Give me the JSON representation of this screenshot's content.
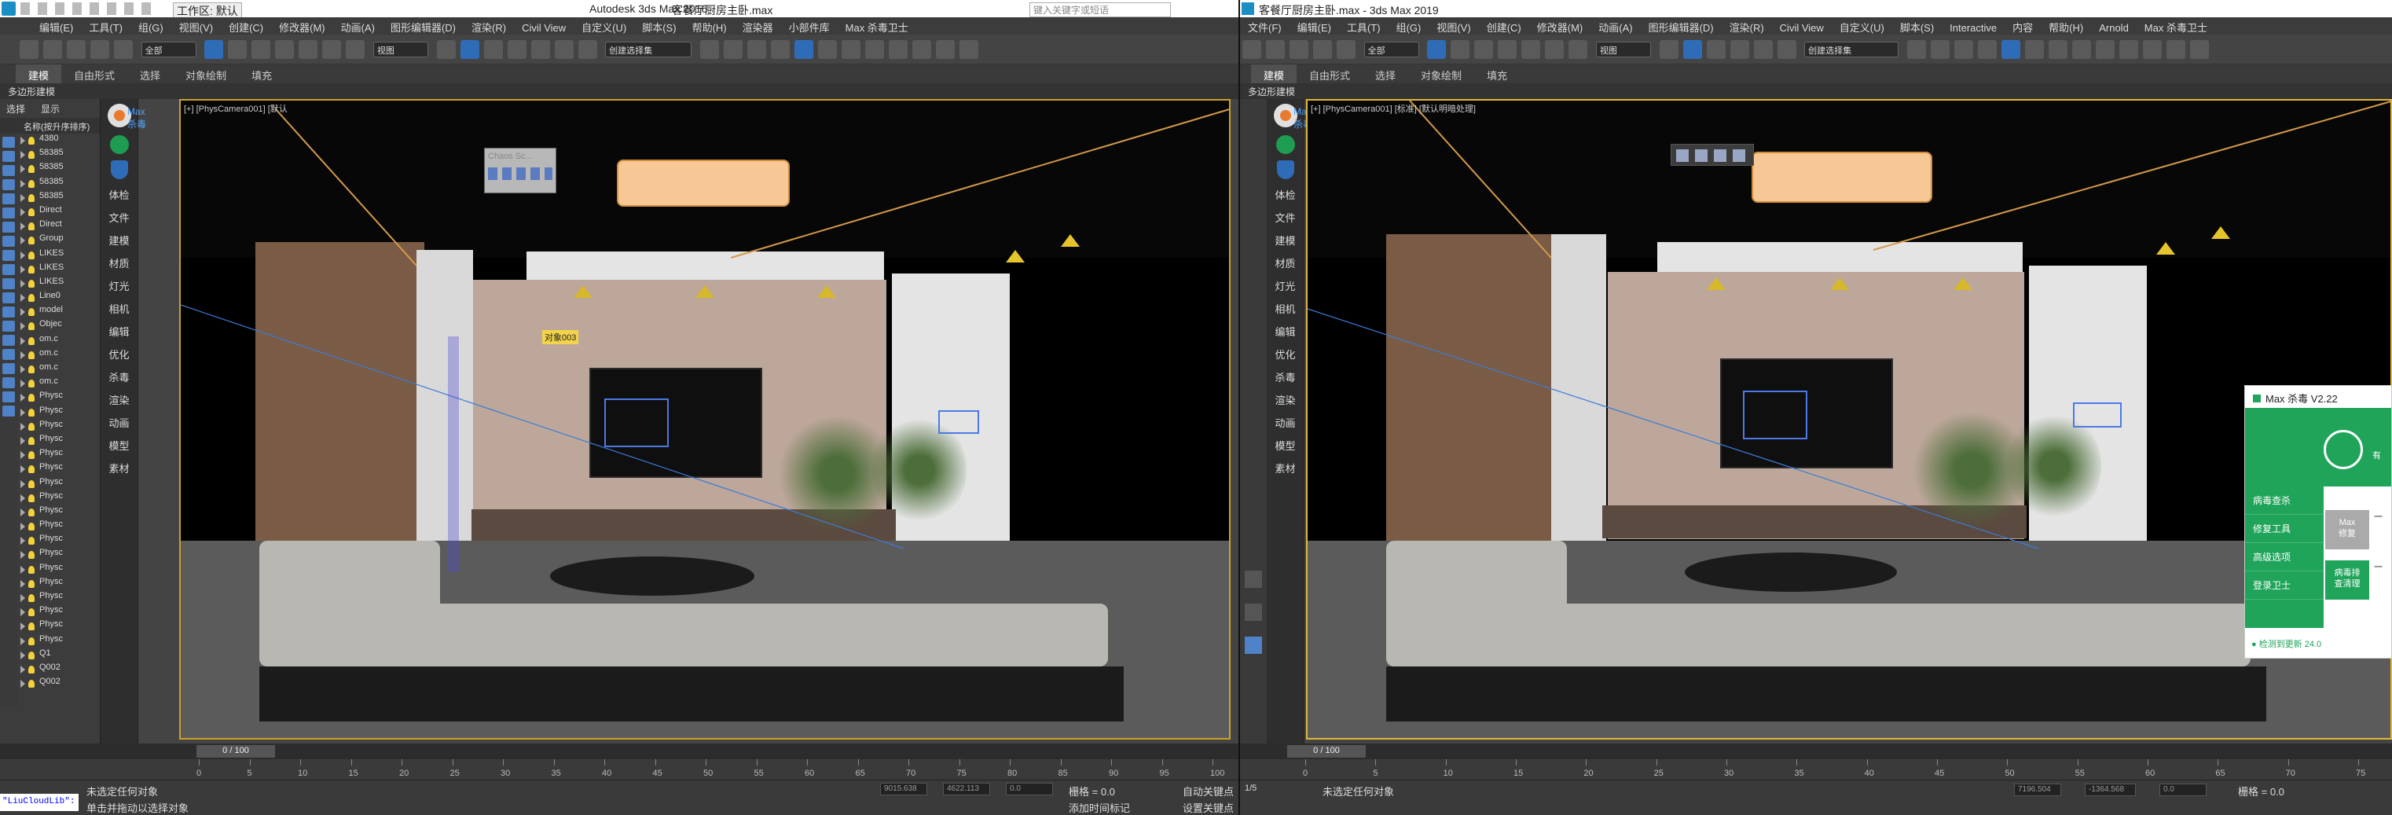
{
  "left_app": {
    "title": "Autodesk 3ds Max 2016",
    "file": "客餐厅厨房主卧.max",
    "workspace": "工作区: 默认",
    "search_placeholder": "键入关键字或短语",
    "menus": [
      "编辑(E)",
      "工具(T)",
      "组(G)",
      "视图(V)",
      "创建(C)",
      "修改器(M)",
      "动画(A)",
      "图形编辑器(D)",
      "渲染(R)",
      "Civil View",
      "自定义(U)",
      "脚本(S)",
      "帮助(H)",
      "渲染器",
      "小部件库",
      "Max 杀毒卫士"
    ],
    "selection_filter": "全部",
    "view_dropdown": "视图",
    "selection_set": "创建选择集",
    "ribbon_tabs": [
      "建模",
      "自由形式",
      "选择",
      "对象绘制",
      "填充"
    ],
    "ribbon_sub": "多边形建模",
    "scene_tabs": [
      "选择",
      "显示"
    ],
    "scene_column": "名称(按升序排序)",
    "scene_items": [
      "4380",
      "58385",
      "58385",
      "58385",
      "58385",
      "Direct",
      "Direct",
      "Group",
      "LIKES",
      "LIKES",
      "LIKES",
      "Line0",
      "model",
      "Objec",
      "om.c",
      "om.c",
      "om.c",
      "om.c",
      "Physc",
      "Physc",
      "Physc",
      "Physc",
      "Physc",
      "Physc",
      "Physc",
      "Physc",
      "Physc",
      "Physc",
      "Physc",
      "Physc",
      "Physc",
      "Physc",
      "Physc",
      "Physc",
      "Physc",
      "Physc",
      "Q1",
      "Q002",
      "Q002"
    ],
    "sidebar": {
      "brand": "Max\n杀毒",
      "items": [
        "体检",
        "文件",
        "建模",
        "材质",
        "灯光",
        "相机",
        "编辑",
        "优化",
        "杀毒",
        "渲染",
        "动画",
        "模型",
        "素材"
      ]
    },
    "viewport_label": "[+] [PhysCamera001] [默认",
    "vray_title": "Chaos Sc...",
    "object_tag": "对象003",
    "frame": "0 / 100",
    "ruler_ticks": [
      "0",
      "5",
      "10",
      "15",
      "20",
      "25",
      "30",
      "35",
      "40",
      "45",
      "50",
      "55",
      "60",
      "65",
      "70",
      "75",
      "80",
      "85",
      "90",
      "95",
      "100"
    ],
    "status_main": "未选定任何对象",
    "status_hint": "单击并拖动以选择对象",
    "x_value": "9015.638",
    "y_value": "4622.113",
    "z_value": "0.0",
    "grid": "栅格 = 0.0",
    "autokey": "自动关键点",
    "setkey": "设置关键点",
    "add_time_tag": "添加时间标记",
    "cmd": "\"LiuCloudLib\":"
  },
  "right_app": {
    "title": "客餐厅厨房主卧.max - 3ds Max 2019",
    "menus": [
      "文件(F)",
      "编辑(E)",
      "工具(T)",
      "组(G)",
      "视图(V)",
      "创建(C)",
      "修改器(M)",
      "动画(A)",
      "图形编辑器(D)",
      "渲染(R)",
      "Civil View",
      "自定义(U)",
      "脚本(S)",
      "Interactive",
      "内容",
      "帮助(H)",
      "Arnold",
      "Max 杀毒卫士"
    ],
    "selection_filter": "全部",
    "view_dropdown": "视图",
    "selection_set": "创建选择集",
    "ribbon_tabs": [
      "建模",
      "自由形式",
      "选择",
      "对象绘制",
      "填充"
    ],
    "ribbon_sub": "多边形建模",
    "sidebar": {
      "brand": "Max\n杀毒",
      "items": [
        "体检",
        "文件",
        "建模",
        "材质",
        "灯光",
        "相机",
        "编辑",
        "优化",
        "杀毒",
        "渲染",
        "动画",
        "模型",
        "素材"
      ]
    },
    "viewport_label": "[+] [PhysCamera001] [标准] [默认明暗处理]",
    "frame": "0 / 100",
    "ruler_ticks": [
      "0",
      "5",
      "10",
      "15",
      "20",
      "25",
      "30",
      "35",
      "40",
      "45",
      "50",
      "55",
      "60",
      "65",
      "70",
      "75"
    ],
    "status_main": "未选定任何对象",
    "x_value": "7196.504",
    "y_value": "-1364.568",
    "z_value": "0.0",
    "grid": "栅格 = 0.0",
    "corner": "1/5"
  },
  "antivirus": {
    "title": "Max 杀毒 V2.22",
    "banner_side": "有",
    "menu": [
      "病毒查杀",
      "修复工具",
      "高级选项",
      "登录卫士"
    ],
    "buttons": [
      "Max\n修复",
      "病毒排\n查清理"
    ],
    "btn_side1": "一",
    "btn_side2": "一",
    "footer": "● 检测到更新 24.0"
  }
}
